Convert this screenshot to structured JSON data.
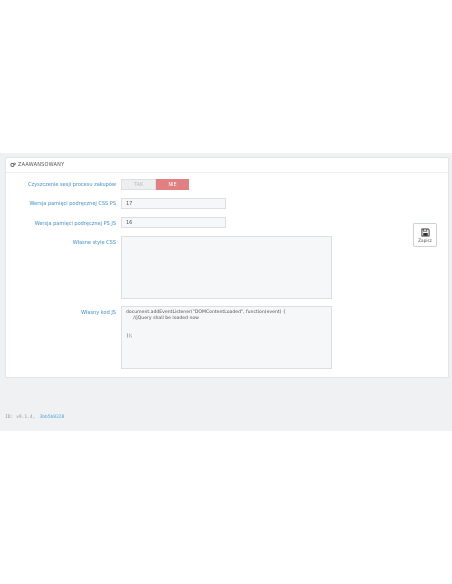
{
  "panel": {
    "title": "ZAAWANSOWANY",
    "icon": "gears-icon"
  },
  "form": {
    "smart_cache_label": "Czyszczenie sesji procesu zakupów",
    "smart_cache_yes": "TAK",
    "smart_cache_no": "NIE",
    "css_cache_label": "Wersja pamięci podręcznej CSS PS",
    "css_cache_value": "17",
    "js_cache_label": "Wersja pamięci podręcznej PS JS",
    "js_cache_value": "16",
    "custom_css_label": "Własne style CSS",
    "custom_css_value": "",
    "custom_js_label": "Własny kod JS",
    "custom_js_value": "document.addEventListener(\"DOMContentLoaded\", function(event) {\n     //jQuery shall be loaded now\n\n\n});"
  },
  "toolbar": {
    "save_label": "Zapisz",
    "save_icon": "floppy-icon"
  },
  "footer": {
    "version_text": "ID: v9.1.4,",
    "link_text": "3bb5b8328"
  },
  "colors": {
    "label": "#3d8fc8",
    "switch_no": "#e08080",
    "band": "#eff1f2"
  }
}
